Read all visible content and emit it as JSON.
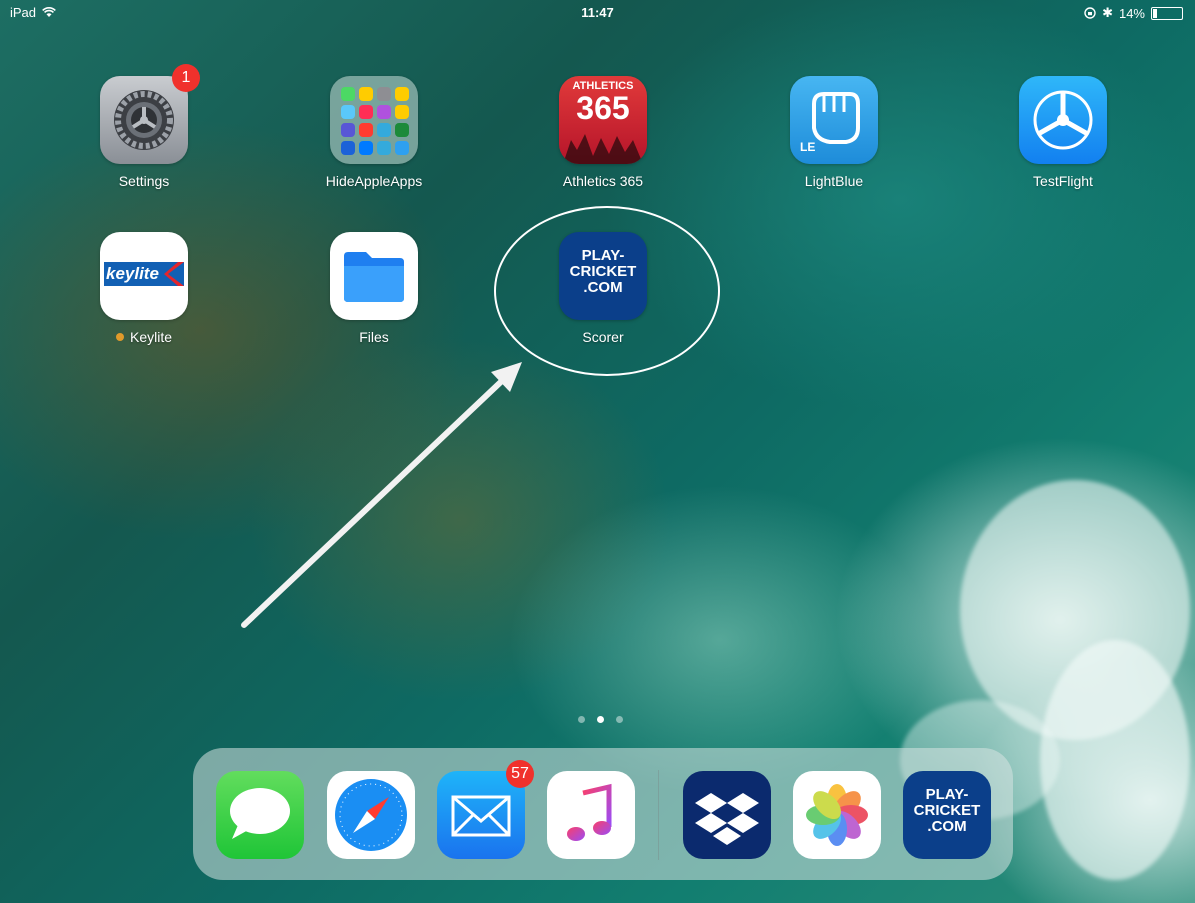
{
  "status_bar": {
    "device": "iPad",
    "time": "11:47",
    "battery_percent": "14%",
    "battery_level": 0.14
  },
  "home_apps": [
    {
      "label": "Settings",
      "badge": "1"
    },
    {
      "label": "HideAppleApps"
    },
    {
      "label": "Athletics 365",
      "icon_text": "ATHLETICS",
      "icon_number": "365"
    },
    {
      "label": "LightBlue",
      "icon_text": "LE"
    },
    {
      "label": "TestFlight"
    },
    {
      "label": "Keylite",
      "icon_text": "keylite"
    },
    {
      "label": "Files"
    },
    {
      "label": "Scorer",
      "icon_lines": [
        "PLAY-",
        "CRICKET",
        ".COM"
      ]
    }
  ],
  "page_indicator": {
    "pages": 3,
    "current": 2
  },
  "dock": {
    "apps": [
      {
        "name": "messages-app"
      },
      {
        "name": "safari-app"
      },
      {
        "name": "mail-app",
        "badge": "57"
      },
      {
        "name": "music-app"
      },
      {
        "name": "dropbox-app"
      },
      {
        "name": "photos-app"
      },
      {
        "name": "play-cricket-app",
        "icon_lines": [
          "PLAY-",
          "CRICKET",
          ".COM"
        ]
      }
    ]
  },
  "colors": {
    "badge": "#f0312c",
    "annotation": "#ffffff",
    "play_cricket_blue": "#0b3f8a"
  }
}
